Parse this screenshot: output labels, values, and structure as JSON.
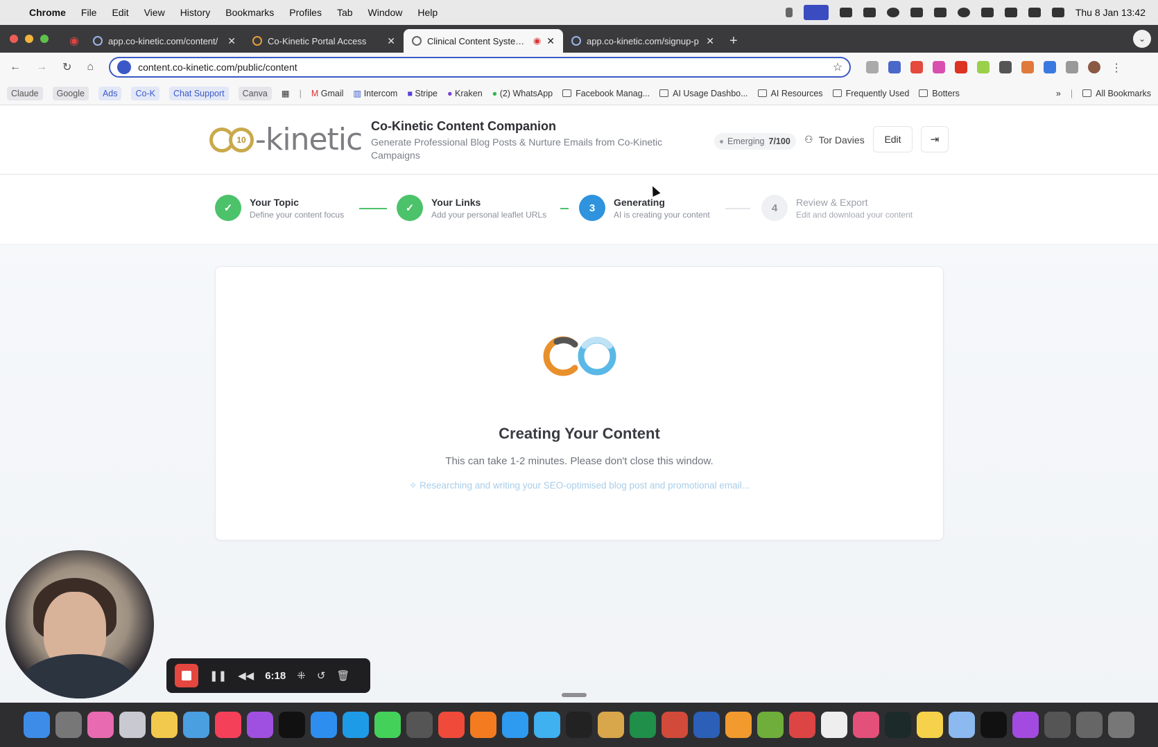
{
  "menubar": {
    "app": "Chrome",
    "items": [
      "File",
      "Edit",
      "View",
      "History",
      "Bookmarks",
      "Profiles",
      "Tab",
      "Window",
      "Help"
    ],
    "clock": "Thu 8 Jan  13:42"
  },
  "tabs": [
    {
      "title": "app.co-kinetic.com/content/",
      "active": false
    },
    {
      "title": "Co-Kinetic Portal Access",
      "active": false
    },
    {
      "title": "Clinical Content System |",
      "active": true
    },
    {
      "title": "app.co-kinetic.com/signup-p",
      "active": false
    }
  ],
  "omnibox": {
    "url": "content.co-kinetic.com/public/content"
  },
  "bookmarks": {
    "chips": [
      "Claude",
      "Google",
      "Ads",
      "Co-K",
      "Chat Support",
      "Canva"
    ],
    "items": [
      "Gmail",
      "Intercom",
      "Stripe",
      "Kraken",
      "(2) WhatsApp"
    ],
    "folders": [
      "Facebook Manag...",
      "AI Usage Dashbo...",
      "AI Resources",
      "Frequently Used",
      "Botters"
    ],
    "more": "»",
    "all": "All Bookmarks"
  },
  "header": {
    "logo_text": "-kinetic",
    "logo_seal": "10",
    "title": "Co-Kinetic Content Companion",
    "subtitle": "Generate Professional Blog Posts & Nurture Emails from Co-Kinetic Campaigns",
    "badge_label": "Emerging",
    "badge_score": "7/100",
    "user_name": "Tor Davies",
    "edit_label": "Edit",
    "logout_icon": "⇥"
  },
  "steps": [
    {
      "num": "1",
      "title": "Your Topic",
      "sub": "Define your content focus",
      "state": "done"
    },
    {
      "num": "2",
      "title": "Your Links",
      "sub": "Add your personal leaflet URLs",
      "state": "done"
    },
    {
      "num": "3",
      "title": "Generating",
      "sub": "AI is creating your content",
      "state": "current"
    },
    {
      "num": "4",
      "title": "Review & Export",
      "sub": "Edit and download your content",
      "state": "todo"
    }
  ],
  "card": {
    "heading": "Creating Your Content",
    "note": "This can take 1-2 minutes. Please don't close this window.",
    "status": "Researching and writing your SEO-optimised blog post and promotional email..."
  },
  "recorder": {
    "time": "6:18"
  },
  "colors": {
    "accent": "#2f93de",
    "success": "#4cc26a",
    "brand_gold": "#c9a94b",
    "brand_orange": "#e8902c"
  }
}
